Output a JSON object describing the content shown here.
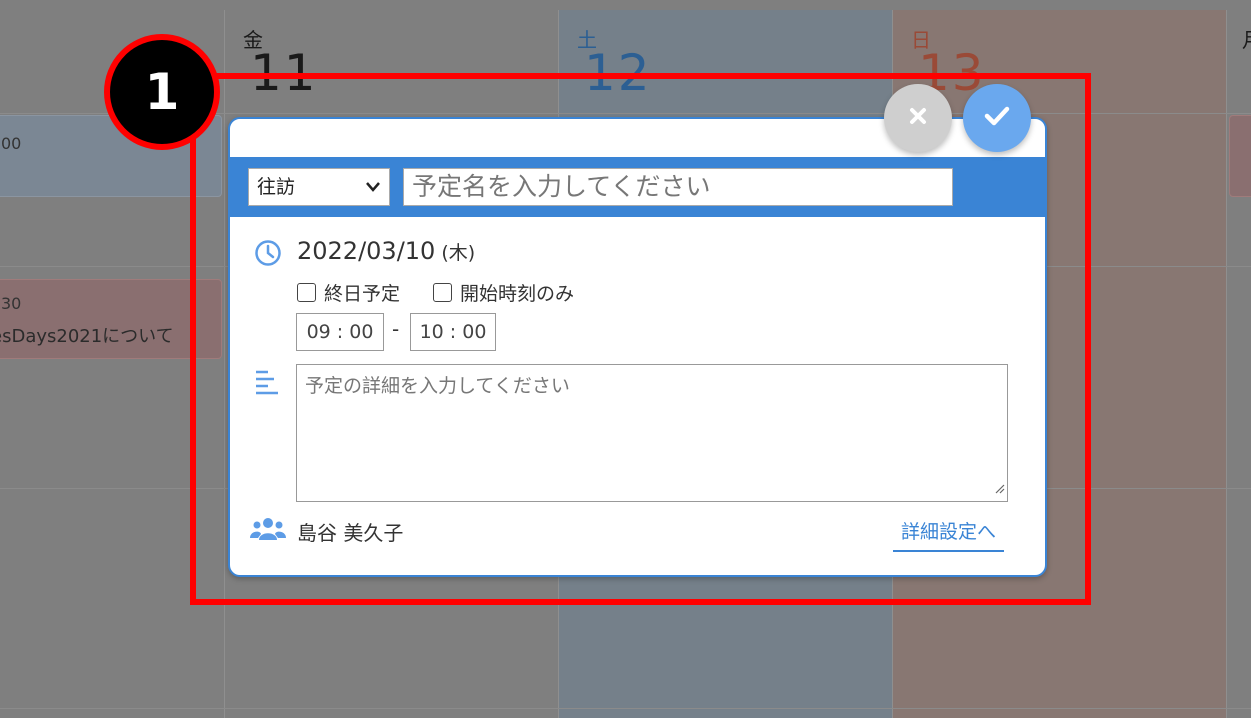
{
  "calendar": {
    "days": [
      {
        "dow": "金",
        "num": "11"
      },
      {
        "dow": "土",
        "num": "12"
      },
      {
        "dow": "日",
        "num": "13"
      },
      {
        "dow": "月",
        "num": ""
      }
    ],
    "events": {
      "event1_time": "00",
      "event2_time": "30",
      "event2_title": "esDays2021について"
    },
    "colors": {
      "saturday": "#3a84d5",
      "sunday": "#d05a3a"
    }
  },
  "annotation": {
    "badge": "1"
  },
  "dialog": {
    "type_select": {
      "value": "往訪"
    },
    "title_input": {
      "placeholder": "予定名を入力してください"
    },
    "date": "2022/03/10",
    "weekday": "(木)",
    "all_day_label": "終日予定",
    "start_only_label": "開始時刻のみ",
    "start_time": "09 : 00",
    "time_separator": "-",
    "end_time": "10 : 00",
    "memo_placeholder": "予定の詳細を入力してください",
    "owner": "島谷 美久子",
    "detail_link": "詳細設定へ",
    "accent_color": "#3a84d5"
  }
}
